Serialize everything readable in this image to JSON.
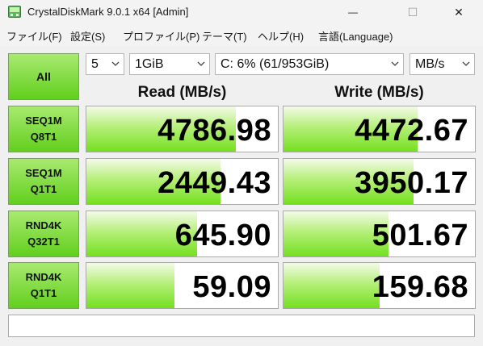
{
  "window": {
    "title": "CrystalDiskMark 9.0.1 x64 [Admin]",
    "minimize_glyph": "—",
    "maximize_glyph": "☐",
    "close_glyph": "✕"
  },
  "menu": [
    {
      "label": "ファイル(F)"
    },
    {
      "label": "設定(S)"
    },
    {
      "label": "プロファイル(P)"
    },
    {
      "label": "テーマ(T)"
    },
    {
      "label": "ヘルプ(H)"
    },
    {
      "label": "言語(Language)"
    }
  ],
  "toolbar": {
    "all_label": "All",
    "count_value": "5",
    "size_value": "1GiB",
    "drive_value": "C: 6% (61/953GiB)",
    "unit_value": "MB/s"
  },
  "headers": {
    "read": "Read (MB/s)",
    "write": "Write (MB/s)"
  },
  "tests": [
    {
      "line1": "SEQ1M",
      "line2": "Q8T1",
      "read": "4786.98",
      "write": "4472.67",
      "read_fill": 0.78,
      "write_fill": 0.7
    },
    {
      "line1": "SEQ1M",
      "line2": "Q1T1",
      "read": "2449.43",
      "write": "3950.17",
      "read_fill": 0.7,
      "write_fill": 0.68
    },
    {
      "line1": "RND4K",
      "line2": "Q32T1",
      "read": "645.90",
      "write": "501.67",
      "read_fill": 0.58,
      "write_fill": 0.55
    },
    {
      "line1": "RND4K",
      "line2": "Q1T1",
      "read": "59.09",
      "write": "159.68",
      "read_fill": 0.46,
      "write_fill": 0.5
    }
  ],
  "comment": {
    "value": ""
  },
  "colors": {
    "accent_green": "#62cf1d",
    "bar_green": "#74e01f"
  },
  "icons": {
    "app": "crystaldiskmark-icon",
    "dropdown": "chevron-down-icon"
  }
}
